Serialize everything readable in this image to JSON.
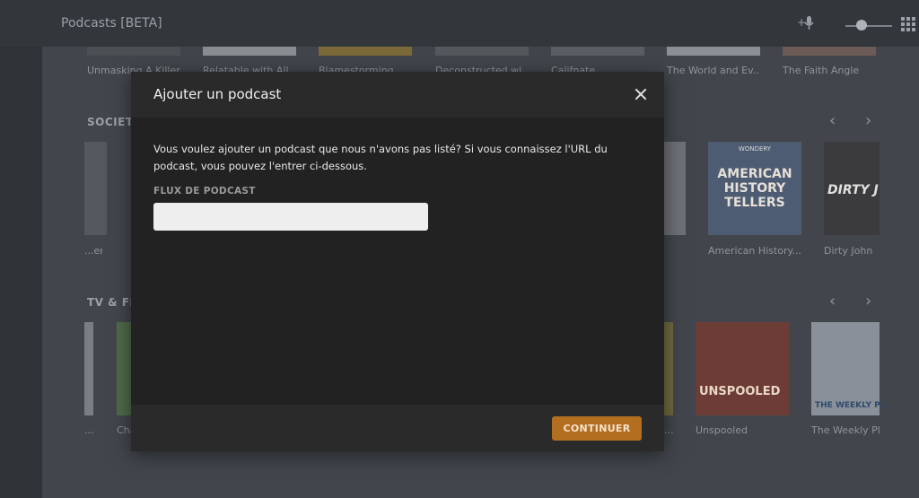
{
  "app": {
    "title": "Podcasts [BETA]"
  },
  "top_row": {
    "captions": [
      "Unmasking A Killer",
      "Relatable with All...",
      "Blamestorming",
      "Deconstructed wi...",
      "Califnate",
      "The World and Ev...",
      "The Faith Angle"
    ]
  },
  "society": {
    "title": "SOCIETY",
    "captions": [
      "...er",
      "American History...",
      "Dirty John"
    ],
    "poster_texts": {
      "wondery": "WONDERY",
      "american_history": "AMERICAN HISTORY TELLERS",
      "dirty_john": "DIRTY J"
    }
  },
  "tv": {
    "title": "TV & FIL",
    "captions": [
      "...",
      "Cha",
      "...",
      "Unspooled",
      "The Weekly Pl..."
    ],
    "poster_texts": {
      "unspooled": "UNSPOOLED",
      "weekly": "THE WEEKLY PL"
    }
  },
  "modal": {
    "title": "Ajouter un podcast",
    "description": "Vous voulez ajouter un podcast que nous n'avons pas listé? Si vous connaissez l'URL du podcast, vous pouvez l'entrer ci-dessous.",
    "field_label": "FLUX DE PODCAST",
    "field_value": "",
    "continue_label": "CONTINUER"
  },
  "colors": {
    "accent": "#b36e1f",
    "modal_bg": "#222222"
  }
}
